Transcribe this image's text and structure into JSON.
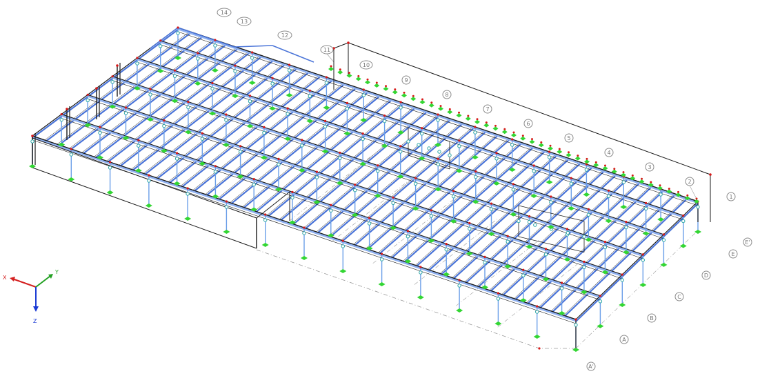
{
  "axis_triad": {
    "x_label": "X",
    "y_label": "Y",
    "z_label": "Z",
    "x_color": "#d42020",
    "y_color": "#22a022",
    "z_color": "#1a3ad4"
  },
  "colors": {
    "beam": "#4a74d8",
    "beam_light": "#8eb0f0",
    "column": "#6a9ee8",
    "frame_dark": "#1a1a1a",
    "node": "#d81818",
    "hinge": "#2aa6a6",
    "support": "#33d633",
    "grid_line": "#9a9a9a",
    "bubble_stroke": "#8a8a8a"
  },
  "grid_bubbles_numbered": [
    "14",
    "13",
    "12",
    "11",
    "10",
    "9",
    "8",
    "7",
    "6",
    "5",
    "4",
    "3",
    "2",
    "1"
  ],
  "grid_bubbles_lettered": [
    "E'",
    "E",
    "D",
    "C",
    "B",
    "A",
    "A'"
  ]
}
